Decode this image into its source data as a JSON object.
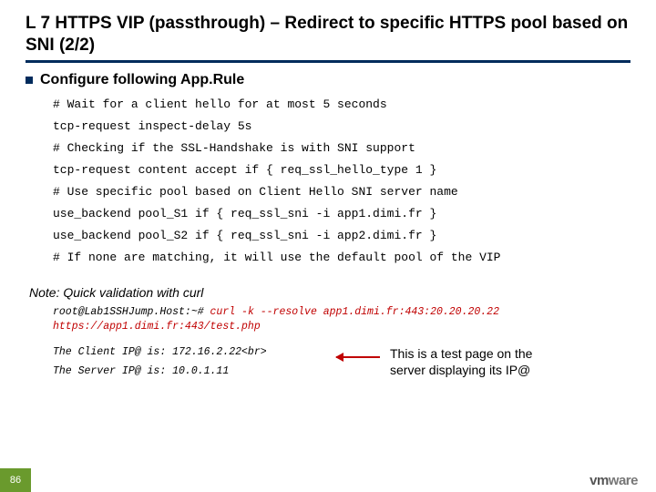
{
  "title": "L 7 HTTPS VIP (passthrough) – Redirect to specific HTTPS pool based on SNI (2/2)",
  "bullet": "Configure following App.Rule",
  "code": {
    "l1": "# Wait for a client hello for at most 5 seconds",
    "l2": "tcp-request inspect-delay 5s",
    "l3": "# Checking if the SSL-Handshake is with SNI support",
    "l4": "tcp-request content accept if { req_ssl_hello_type 1 }",
    "l5": "# Use specific pool based on Client Hello SNI server name",
    "l6": "use_backend pool_S1 if { req_ssl_sni -i app1.dimi.fr }",
    "l7": "use_backend pool_S2 if { req_ssl_sni -i app2.dimi.fr }",
    "l8": "# If none are matching, it will use the default pool of the VIP"
  },
  "note": "Note: Quick validation with curl",
  "curl": {
    "prefix": "root@Lab1SSHJump.Host:~# ",
    "cmd": "curl -k --resolve app1.dimi.fr:443:20.20.20.22 https://app1.dimi.fr:443/test.php"
  },
  "output": {
    "l1": "The Client IP@ is: 172.16.2.22<br>",
    "l2": "The Server IP@ is: 10.0.1.11"
  },
  "annotation": "This is a test page on the server displaying its IP@",
  "page": "86",
  "logo": {
    "a": "vm",
    "b": "ware"
  }
}
